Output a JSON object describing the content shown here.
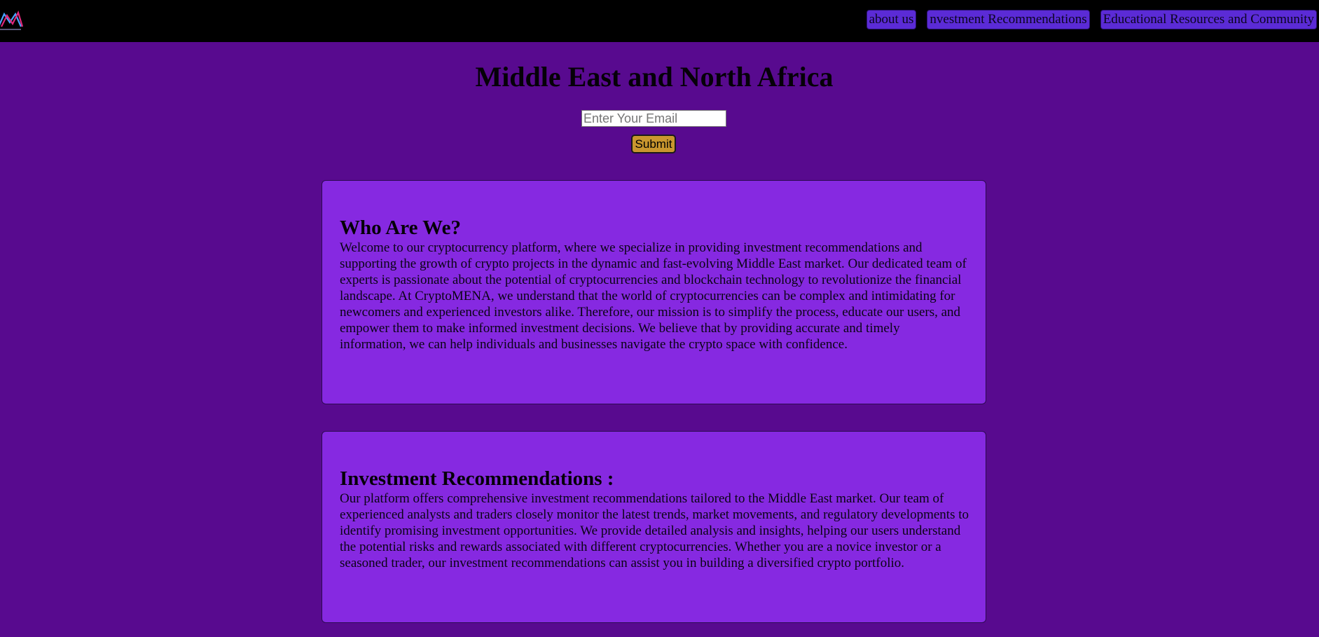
{
  "header": {
    "logo_icon": "cryptomena-logo-icon",
    "nav": [
      {
        "label": "about us"
      },
      {
        "label": "nvestment Recommendations"
      },
      {
        "label": "Educational Resources and Community"
      }
    ]
  },
  "hero": {
    "title": "Middle East and North Africa",
    "email_placeholder": "Enter Your Email",
    "submit_label": "Submit"
  },
  "sections": [
    {
      "heading": "Who Are We?",
      "body": "Welcome to our cryptocurrency platform, where we specialize in providing investment recommendations and supporting the growth of crypto projects in the dynamic and fast-evolving Middle East market. Our dedicated team of experts is passionate about the potential of cryptocurrencies and blockchain technology to revolutionize the financial landscape. At CryptoMENA, we understand that the world of cryptocurrencies can be complex and intimidating for newcomers and experienced investors alike. Therefore, our mission is to simplify the process, educate our users, and empower them to make informed investment decisions. We believe that by providing accurate and timely information, we can help individuals and businesses navigate the crypto space with confidence."
    },
    {
      "heading": "Investment Recommendations :",
      "body": "Our platform offers comprehensive investment recommendations tailored to the Middle East market. Our team of experienced analysts and traders closely monitor the latest trends, market movements, and regulatory developments to identify promising investment opportunities. We provide detailed analysis and insights, helping our users understand the potential risks and rewards associated with different cryptocurrencies. Whether you are a novice investor or a seasoned trader, our investment recommendations can assist you in building a diversified crypto portfolio."
    }
  ],
  "colors": {
    "page_bg": "#580a8f",
    "header_bg": "#000000",
    "card_bg": "#8629e1",
    "nav_button_bg": "#5b2bd6",
    "submit_bg": "#c9962e"
  }
}
